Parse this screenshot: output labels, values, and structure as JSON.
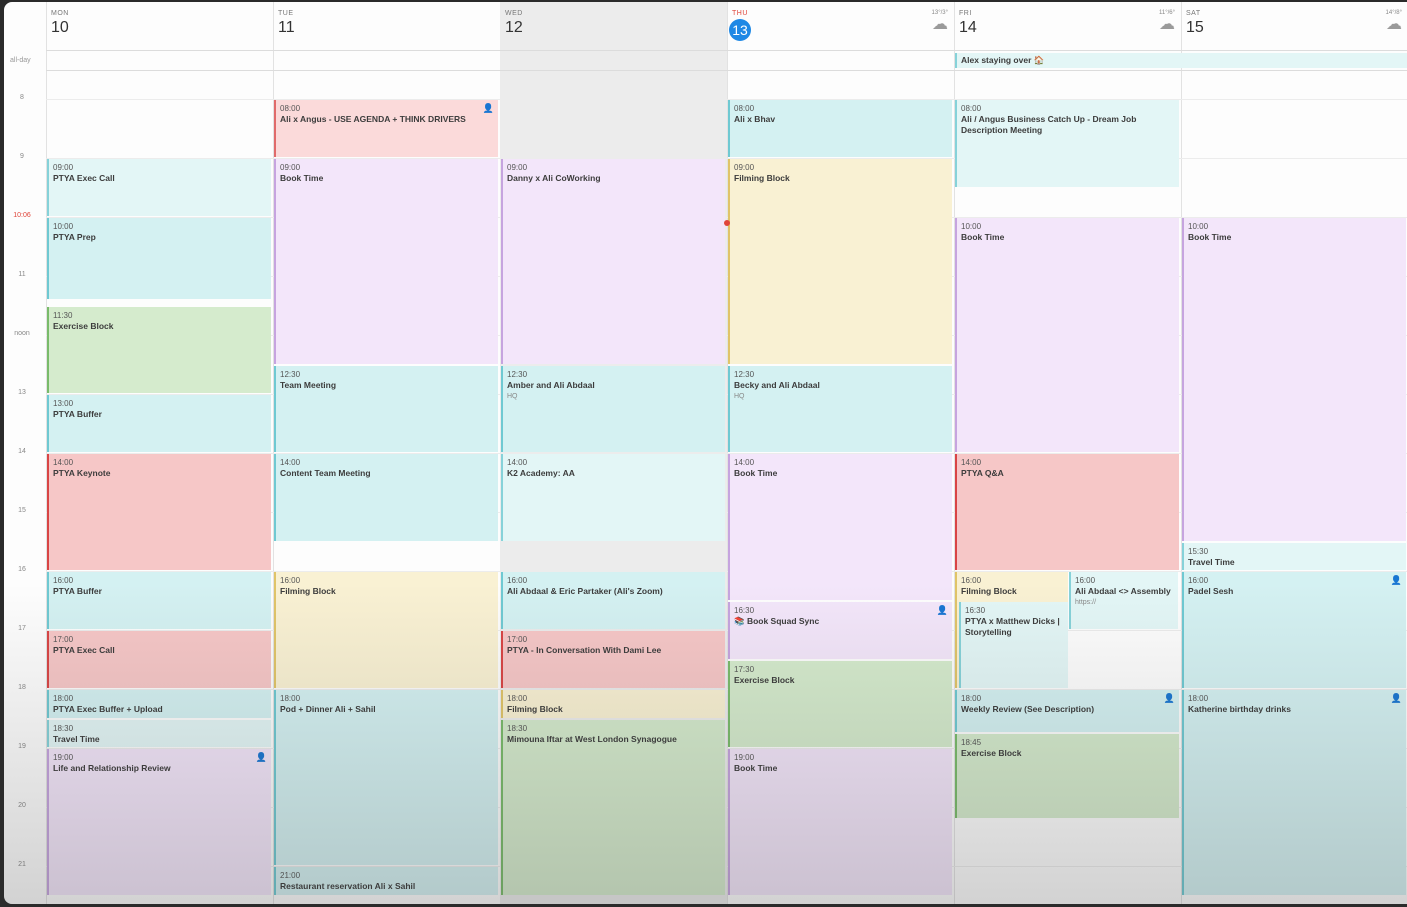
{
  "days": [
    {
      "dow": "MON",
      "num": "10"
    },
    {
      "dow": "TUE",
      "num": "11"
    },
    {
      "dow": "WED",
      "num": "12"
    },
    {
      "dow": "THU",
      "num": "13",
      "today": true,
      "weather": "13°/3°"
    },
    {
      "dow": "FRI",
      "num": "14",
      "weather": "11°/6°"
    },
    {
      "dow": "SAT",
      "num": "15",
      "weather": "14°/8°"
    }
  ],
  "allday_label": "all-day",
  "allday_events": [
    {
      "day": 4,
      "span": 2,
      "title": "Alex staying over 🏠"
    }
  ],
  "hours": [
    "8",
    "9",
    "10:06",
    "11",
    "noon",
    "13",
    "14",
    "15",
    "16",
    "17",
    "18",
    "19",
    "20",
    "21"
  ],
  "events": [
    {
      "day": 0,
      "start": 9.0,
      "end": 10.0,
      "time": "09:00",
      "title": "PTYA Exec Call",
      "color": "cyanL"
    },
    {
      "day": 0,
      "start": 10.0,
      "end": 11.4,
      "time": "10:00",
      "title": "PTYA Prep",
      "color": "cyan"
    },
    {
      "day": 0,
      "start": 11.5,
      "end": 13.0,
      "time": "11:30",
      "title": "Exercise Block",
      "color": "green"
    },
    {
      "day": 0,
      "start": 13.0,
      "end": 14.0,
      "time": "13:00",
      "title": "PTYA Buffer",
      "color": "cyan"
    },
    {
      "day": 0,
      "start": 14.0,
      "end": 16.0,
      "time": "14:00",
      "title": "PTYA Keynote",
      "color": "red"
    },
    {
      "day": 0,
      "start": 16.0,
      "end": 17.0,
      "time": "16:00",
      "title": "PTYA Buffer",
      "color": "cyan"
    },
    {
      "day": 0,
      "start": 17.0,
      "end": 18.0,
      "time": "17:00",
      "title": "PTYA Exec Call",
      "color": "red"
    },
    {
      "day": 0,
      "start": 18.0,
      "end": 18.5,
      "time": "18:00",
      "title": "PTYA Exec Buffer + Upload",
      "color": "cyan"
    },
    {
      "day": 0,
      "start": 18.5,
      "end": 19.0,
      "time": "18:30",
      "title": "Travel Time",
      "color": "cyanL"
    },
    {
      "day": 0,
      "start": 19.0,
      "end": 21.5,
      "time": "19:00",
      "title": "Life and Relationship Review",
      "color": "purple",
      "people": true
    },
    {
      "day": 1,
      "start": 8.0,
      "end": 9.0,
      "time": "08:00",
      "title": "Ali x Angus - USE AGENDA + THINK DRIVERS",
      "color": "pink",
      "people": true
    },
    {
      "day": 1,
      "start": 9.0,
      "end": 12.5,
      "time": "09:00",
      "title": "Book Time",
      "color": "purple"
    },
    {
      "day": 1,
      "start": 12.5,
      "end": 14.0,
      "time": "12:30",
      "title": "Team Meeting",
      "color": "cyan"
    },
    {
      "day": 1,
      "start": 14.0,
      "end": 15.5,
      "time": "14:00",
      "title": "Content Team Meeting",
      "color": "cyan"
    },
    {
      "day": 1,
      "start": 16.0,
      "end": 18.0,
      "time": "16:00",
      "title": "Filming Block",
      "color": "yellow"
    },
    {
      "day": 1,
      "start": 18.0,
      "end": 21.0,
      "time": "18:00",
      "title": "Pod + Dinner Ali + Sahil",
      "color": "cyan"
    },
    {
      "day": 1,
      "start": 21.0,
      "end": 21.5,
      "time": "21:00",
      "title": "Restaurant reservation Ali x Sahil",
      "color": "cyan"
    },
    {
      "day": 2,
      "start": 9.0,
      "end": 12.5,
      "time": "09:00",
      "title": "Danny x Ali CoWorking",
      "color": "purple"
    },
    {
      "day": 2,
      "start": 12.5,
      "end": 14.0,
      "time": "12:30",
      "title": "Amber and Ali Abdaal",
      "sub": "HQ",
      "color": "cyan"
    },
    {
      "day": 2,
      "start": 14.0,
      "end": 15.5,
      "time": "14:00",
      "title": "K2 Academy: AA",
      "color": "cyanL"
    },
    {
      "day": 2,
      "start": 16.0,
      "end": 17.0,
      "time": "16:00",
      "title": "Ali Abdaal & Eric Partaker (Ali's Zoom)",
      "color": "cyan"
    },
    {
      "day": 2,
      "start": 17.0,
      "end": 18.0,
      "time": "17:00",
      "title": "PTYA - In Conversation With Dami Lee",
      "color": "red"
    },
    {
      "day": 2,
      "start": 18.0,
      "end": 18.5,
      "time": "18:00",
      "title": "Filming Block",
      "color": "yellow"
    },
    {
      "day": 2,
      "start": 18.5,
      "end": 21.5,
      "time": "18:30",
      "title": "Mimouna Iftar at West London Synagogue",
      "color": "green"
    },
    {
      "day": 3,
      "start": 8.0,
      "end": 9.0,
      "time": "08:00",
      "title": "Ali x Bhav",
      "color": "cyan"
    },
    {
      "day": 3,
      "start": 9.0,
      "end": 12.5,
      "time": "09:00",
      "title": "Filming Block",
      "color": "yellow"
    },
    {
      "day": 3,
      "start": 12.5,
      "end": 14.0,
      "time": "12:30",
      "title": "Becky and Ali Abdaal",
      "sub": "HQ",
      "color": "cyan"
    },
    {
      "day": 3,
      "start": 14.0,
      "end": 16.5,
      "time": "14:00",
      "title": "Book Time",
      "color": "purple"
    },
    {
      "day": 3,
      "start": 16.5,
      "end": 17.5,
      "time": "16:30",
      "title": "📚 Book Squad Sync",
      "color": "purple",
      "people": true
    },
    {
      "day": 3,
      "start": 17.5,
      "end": 19.0,
      "time": "17:30",
      "title": "Exercise Block",
      "color": "green"
    },
    {
      "day": 3,
      "start": 19.0,
      "end": 21.5,
      "time": "19:00",
      "title": "Book Time",
      "color": "purple"
    },
    {
      "day": 4,
      "start": 8.0,
      "end": 9.5,
      "time": "08:00",
      "title": "Ali / Angus Business Catch Up - Dream Job Description Meeting",
      "color": "cyanL"
    },
    {
      "day": 4,
      "start": 10.0,
      "end": 14.0,
      "time": "10:00",
      "title": "Book Time",
      "color": "purple"
    },
    {
      "day": 4,
      "start": 14.0,
      "end": 16.0,
      "time": "14:00",
      "title": "PTYA Q&A",
      "color": "red"
    },
    {
      "day": 4,
      "start": 16.0,
      "end": 18.0,
      "time": "16:00",
      "title": "Filming Block",
      "color": "yellow",
      "half": "left"
    },
    {
      "day": 4,
      "start": 16.5,
      "end": 18.0,
      "time": "16:30",
      "title": "PTYA x Matthew Dicks | Storytelling",
      "color": "cyanL",
      "half": "left",
      "inset": true
    },
    {
      "day": 4,
      "start": 16.0,
      "end": 17.0,
      "time": "16:00",
      "title": "Ali Abdaal <> Assembly",
      "sub": "https://",
      "color": "cyanL",
      "half": "right"
    },
    {
      "day": 4,
      "start": 18.0,
      "end": 18.75,
      "time": "18:00",
      "title": "Weekly Review (See Description)",
      "color": "cyan",
      "people": true
    },
    {
      "day": 4,
      "start": 18.75,
      "end": 20.2,
      "time": "18:45",
      "title": "Exercise Block",
      "color": "green"
    },
    {
      "day": 5,
      "start": 10.0,
      "end": 15.5,
      "time": "10:00",
      "title": "Book Time",
      "color": "purple"
    },
    {
      "day": 5,
      "start": 15.5,
      "end": 16.0,
      "time": "15:30",
      "title": "Travel Time",
      "color": "cyanL"
    },
    {
      "day": 5,
      "start": 16.0,
      "end": 18.0,
      "time": "16:00",
      "title": "Padel Sesh",
      "color": "cyan",
      "people": true
    },
    {
      "day": 5,
      "start": 18.0,
      "end": 21.5,
      "time": "18:00",
      "title": "Katherine birthday drinks",
      "color": "cyan",
      "people": true
    }
  ]
}
